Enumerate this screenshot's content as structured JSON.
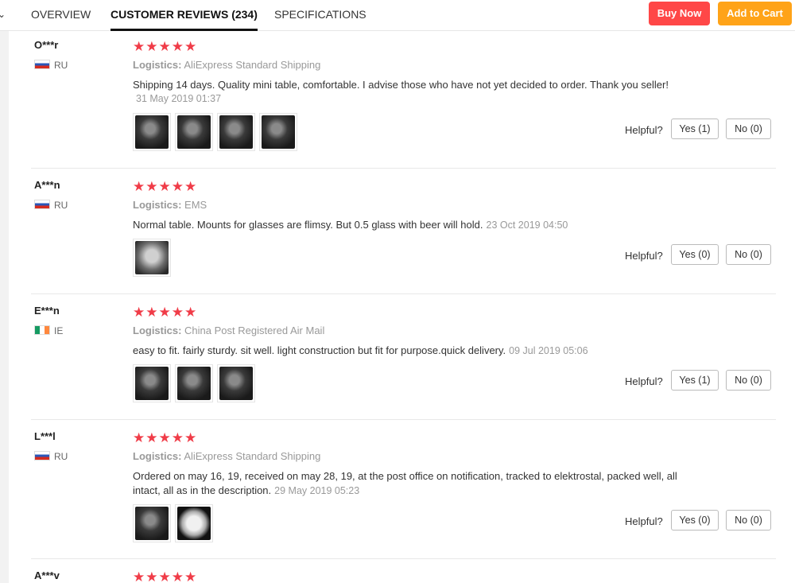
{
  "header": {
    "collapse_icon": "chevron-down-icon",
    "tabs": [
      {
        "label": "OVERVIEW"
      },
      {
        "label": "CUSTOMER REVIEWS (234)"
      },
      {
        "label": "SPECIFICATIONS"
      }
    ],
    "buy_now_label": "Buy Now",
    "add_to_cart_label": "Add to Cart"
  },
  "colors": {
    "star": "#f03c48",
    "buy_now": "#ff4747",
    "add_to_cart": "#ffa318"
  },
  "logistics_label": "Logistics:",
  "helpful_label": "Helpful?",
  "reviews": [
    {
      "user": "O***r",
      "country": "RU",
      "stars": "★★★★★",
      "rating": 5,
      "logistics": "AliExpress Standard Shipping",
      "text": "Shipping 14 days. Quality mini table, comfortable. I advise those who have not yet decided to order. Thank you seller!",
      "date": "31 May 2019 01:37",
      "photo_count": 4,
      "yes": "Yes (1)",
      "no": "No (0)"
    },
    {
      "user": "A***n",
      "country": "RU",
      "stars": "★★★★★",
      "rating": 5,
      "logistics": "EMS",
      "text": "Normal table. Mounts for glasses are flimsy. But 0.5 glass with beer will hold.",
      "date": "23 Oct 2019 04:50",
      "photo_count": 1,
      "yes": "Yes (0)",
      "no": "No (0)"
    },
    {
      "user": "E***n",
      "country": "IE",
      "stars": "★★★★★",
      "rating": 5,
      "logistics": "China Post Registered Air Mail",
      "text": "easy to fit. fairly sturdy. sit well. light construction but fit for purpose.quick delivery.",
      "date": "09 Jul 2019 05:06",
      "photo_count": 3,
      "yes": "Yes (1)",
      "no": "No (0)"
    },
    {
      "user": "L***l",
      "country": "RU",
      "stars": "★★★★★",
      "rating": 5,
      "logistics": "AliExpress Standard Shipping",
      "text": "Ordered on may 16, 19, received on may 28, 19, at the post office on notification, tracked to elektrostal, packed well, all intact, all as in the description.",
      "date": "29 May 2019 05:23",
      "photo_count": 2,
      "yes": "Yes (0)",
      "no": "No (0)"
    },
    {
      "user": "A***v",
      "stars": "★★★★★",
      "rating": 5
    }
  ]
}
